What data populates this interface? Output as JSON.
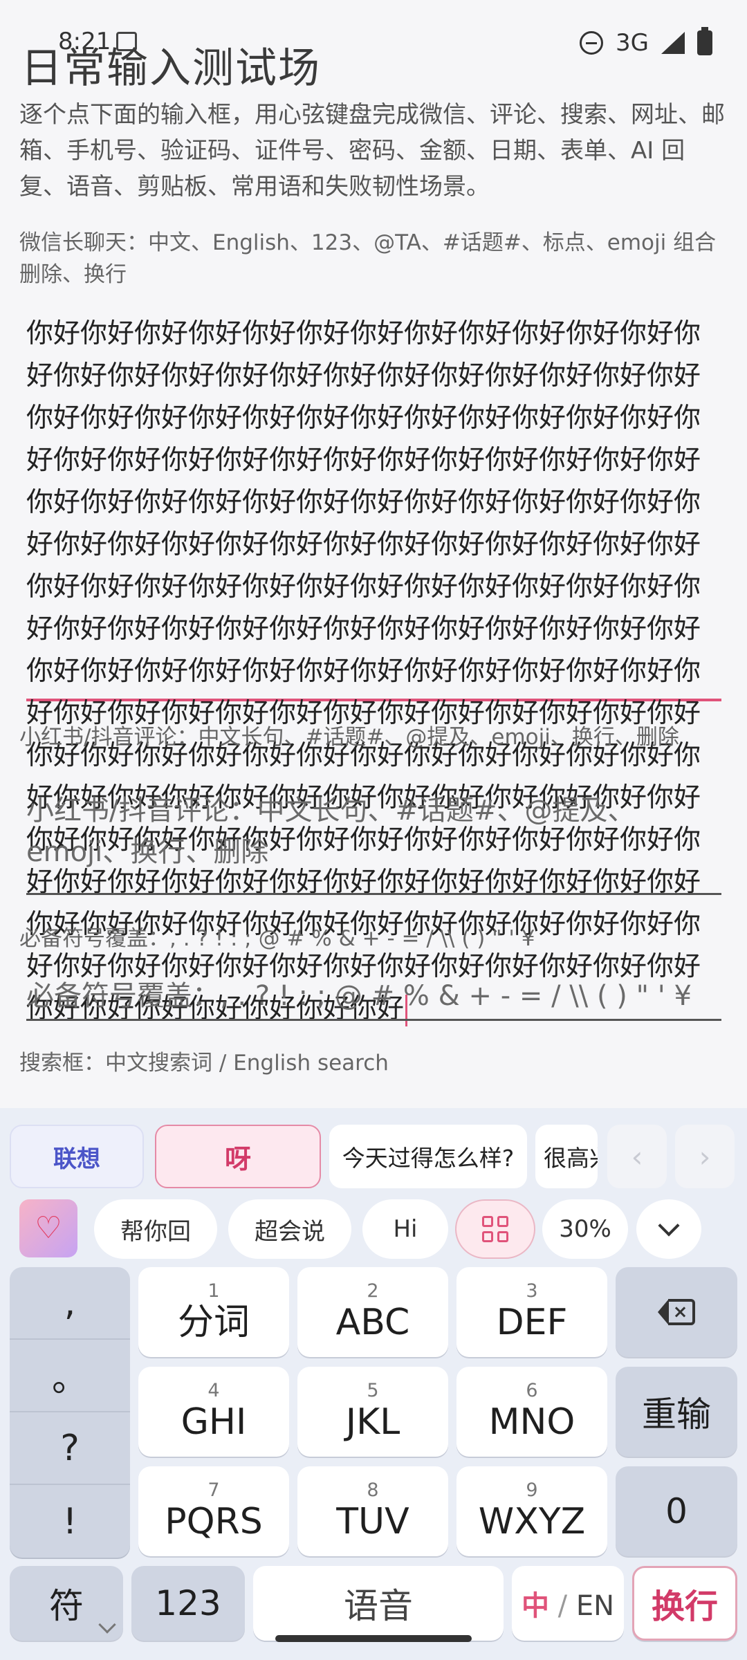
{
  "status": {
    "time": "8:21",
    "network": "3G"
  },
  "page": {
    "title": "日常输入测试场",
    "intro": "逐个点下面的输入框，用心弦键盘完成微信、评论、搜索、网址、邮箱、手机号、验证码、证件号、密码、金额、日期、表单、AI 回复、语音、剪贴板、常用语和失败韧性场景。"
  },
  "fields": {
    "wechat": {
      "label": "微信长聊天：中文、English、123、@TA、#话题#、标点、emoji 组合删除、换行",
      "value": "你好你好你好你好你好你好你好你好你好你好你好你好你好你好你好你好你好你好你好你好你好你好你好你好你好你好你好你好你好你好你好你好你好你好你好你好你好你好你好你好你好你好你好你好你好你好你好你好你好你好你好你好你好你好你好你好你好你好你好你好你好你好你好你好你好你好你好你好你好你好你好你好你好你好你好你好你好你好你好你好你好你好你好你好你好你好你好你好你好你好你好你好你好你好你好你好你好你好你好你好你好你好你好你好你好你好你好你好你好你好你好你好你好你好你好你好你好你好你好你好你好你好你好你好你好你好你好你好你好你好你好你好你好你好你好你好你好你好你好你好你好你好你好你好你好你好你好你好你好你好你好你好你好你好你好你好你好你好你好你好你好你好你好你好你好你好你好你好你好你好你好你好你好你好你好你好你好你好你好你好你好你好你好你好你好你好你好你好你好你好你好你好你好你好你好你好你好你好你好你好你好你好你好你好你好你好你好"
    },
    "comment": {
      "label": "小红书/抖音评论：中文长句、#话题#、@提及、emoji、换行、删除",
      "placeholder": "小红书/抖音评论：中文长句、#话题#、@提及、emoji、换行、删除"
    },
    "symbols": {
      "label": "必备符号覆盖：, . ? ! : ; @ # % & + - = / \\\\ ( ) \" ' ¥",
      "placeholder": "必备符号覆盖：, . ? ! : ; @ # % & + - = / \\\\ ( ) \" ' ¥"
    },
    "search": {
      "label": "搜索框：中文搜索词 / English search"
    }
  },
  "keyboard": {
    "candidates": {
      "assoc": "联想",
      "first": "呀",
      "c2": "今天过得怎么样?",
      "c3": "很高兴",
      "prev": "‹",
      "next": "›"
    },
    "tools": {
      "help_reply": "帮你回",
      "super_talk": "超会说",
      "hi": "Hi",
      "percent": "30%"
    },
    "punct": [
      ",",
      "。",
      "?",
      "!"
    ],
    "keys": [
      {
        "num": "1",
        "letters": "分词"
      },
      {
        "num": "2",
        "letters": "ABC"
      },
      {
        "num": "3",
        "letters": "DEF"
      },
      {
        "num": "4",
        "letters": "GHI"
      },
      {
        "num": "5",
        "letters": "JKL"
      },
      {
        "num": "6",
        "letters": "MNO"
      },
      {
        "num": "7",
        "letters": "PQRS"
      },
      {
        "num": "8",
        "letters": "TUV"
      },
      {
        "num": "9",
        "letters": "WXYZ"
      }
    ],
    "retype": "重输",
    "zero": "0",
    "symbol": "符",
    "numbers": "123",
    "voice": "语音",
    "lang": {
      "zh": "中",
      "sep": "/",
      "en": "EN"
    },
    "enter": "换行"
  },
  "colors": {
    "accent": "#e0537a",
    "assoc": "#4b55c8"
  }
}
